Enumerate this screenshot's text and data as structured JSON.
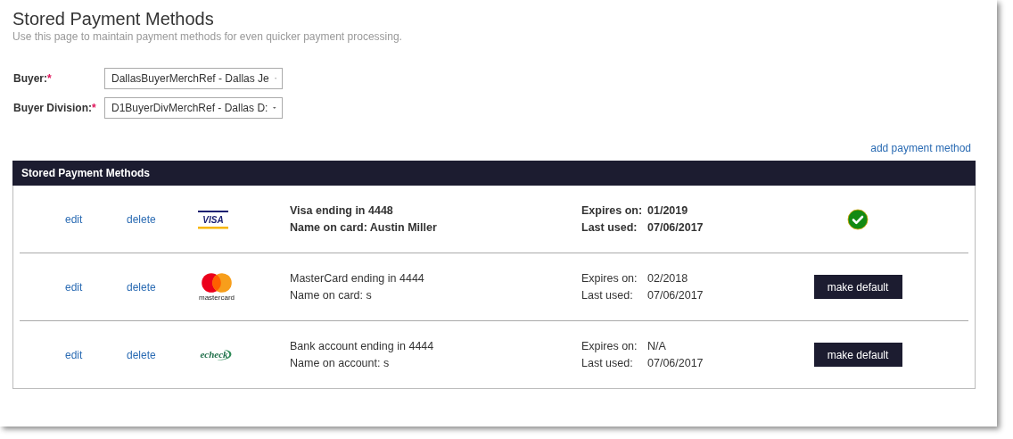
{
  "page": {
    "title": "Stored Payment Methods",
    "subtitle": "Use this page to maintain payment methods for even quicker payment processing."
  },
  "fields": [
    {
      "label": "Buyer:",
      "required_mark": "*",
      "value": "DallasBuyerMerchRef - Dallas Je"
    },
    {
      "label": "Buyer Division:",
      "required_mark": "*",
      "value": "D1BuyerDivMerchRef - Dallas D:"
    }
  ],
  "add_link": "add payment method",
  "panel": {
    "title": "Stored Payment Methods",
    "methods": [
      {
        "kind": "visa",
        "edit": "edit",
        "delete": "delete",
        "logo_text": "VISA",
        "line_1": "Visa ending in 4448",
        "line_2": "Name on card: Austin Miller",
        "expires_label": "Expires on:",
        "expires": "01/2019",
        "used_label": "Last used:",
        "used": "07/06/2017",
        "default": true
      },
      {
        "kind": "mastercard",
        "edit": "edit",
        "delete": "delete",
        "logo_text": "mastercard",
        "line_1": "MasterCard ending in 4444",
        "line_2": "Name on card: s",
        "expires_label": "Expires on:",
        "expires": "02/2018",
        "used_label": "Last used:",
        "used": "07/06/2017",
        "default": false,
        "action": "make default"
      },
      {
        "kind": "echeck",
        "edit": "edit",
        "delete": "delete",
        "logo_text": "echeck",
        "line_1": "Bank account ending in 4444",
        "line_2": "Name on account: s",
        "expires_label": "Expires on:",
        "expires": "N/A",
        "used_label": "Last used:",
        "used": "07/06/2017",
        "default": false,
        "action": "make default"
      }
    ]
  }
}
